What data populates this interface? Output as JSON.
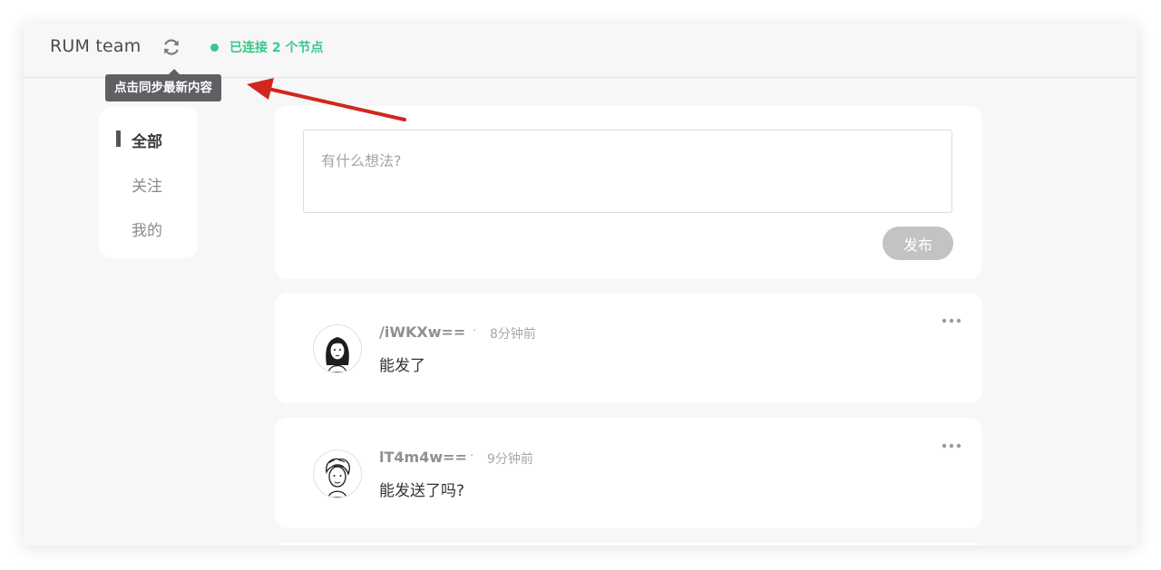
{
  "header": {
    "app_title": "RUM team",
    "sync_icon": "refresh-icon",
    "status_text": "已连接 2 个节点",
    "status_color": "#38c98a",
    "sync_tooltip": "点击同步最新内容"
  },
  "sidebar": {
    "items": [
      {
        "label": "全部",
        "active": true
      },
      {
        "label": "关注",
        "active": false
      },
      {
        "label": "我的",
        "active": false
      }
    ]
  },
  "composer": {
    "placeholder": "有什么想法?",
    "value": "",
    "publish_label": "发布",
    "publish_color": "#c3c3c6"
  },
  "feed": {
    "posts": [
      {
        "author": "/iWKXw==",
        "time": "8分钟前",
        "content": "能发了",
        "avatar_icon": "woman-avatar-icon",
        "more_icon": "more-dots-icon"
      },
      {
        "author": "lT4m4w==",
        "time": "9分钟前",
        "content": "能发送了吗?",
        "avatar_icon": "man-avatar-icon",
        "more_icon": "more-dots-icon"
      }
    ]
  },
  "annotation": {
    "arrow_color": "#d0281f"
  }
}
